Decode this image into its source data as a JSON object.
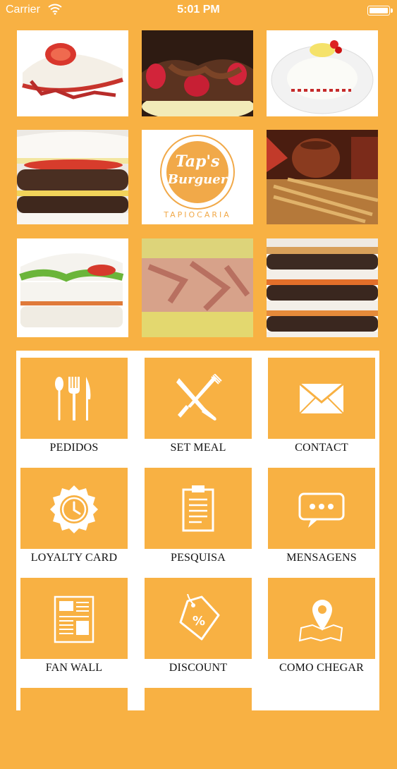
{
  "status_bar": {
    "carrier": "Carrier",
    "time": "5:01 PM"
  },
  "colors": {
    "accent": "#f8b143",
    "tile_text": "#111111",
    "panel": "#ffffff"
  },
  "gallery": {
    "photos": [
      {
        "name": "tapioca-tomato-photo"
      },
      {
        "name": "tapioca-chocolate-strawberry-photo"
      },
      {
        "name": "tapioca-plate-photo"
      },
      {
        "name": "burger-tapioca-photo"
      },
      {
        "name": "taps-burguer-logo",
        "logo_text": "Tap's Burguer",
        "logo_subtext": "TAPIOCARIA"
      },
      {
        "name": "pottery-craft-photo"
      },
      {
        "name": "tapioca-salad-photo"
      },
      {
        "name": "tapioca-chicken-photo"
      },
      {
        "name": "double-burger-tapioca-photo"
      }
    ]
  },
  "menu": {
    "items": [
      {
        "label": "PEDIDOS",
        "icon": "cutlery-icon"
      },
      {
        "label": "SET MEAL",
        "icon": "knife-fork-cross-icon"
      },
      {
        "label": "CONTACT",
        "icon": "envelope-icon"
      },
      {
        "label": "LOYALTY CARD",
        "icon": "badge-check-icon"
      },
      {
        "label": "PESQUISA",
        "icon": "clipboard-icon"
      },
      {
        "label": "MENSAGENS",
        "icon": "chat-bubble-icon"
      },
      {
        "label": "FAN WALL",
        "icon": "newspaper-icon"
      },
      {
        "label": "DISCOUNT",
        "icon": "percent-tag-icon"
      },
      {
        "label": "COMO CHEGAR",
        "icon": "map-pin-icon"
      }
    ]
  }
}
